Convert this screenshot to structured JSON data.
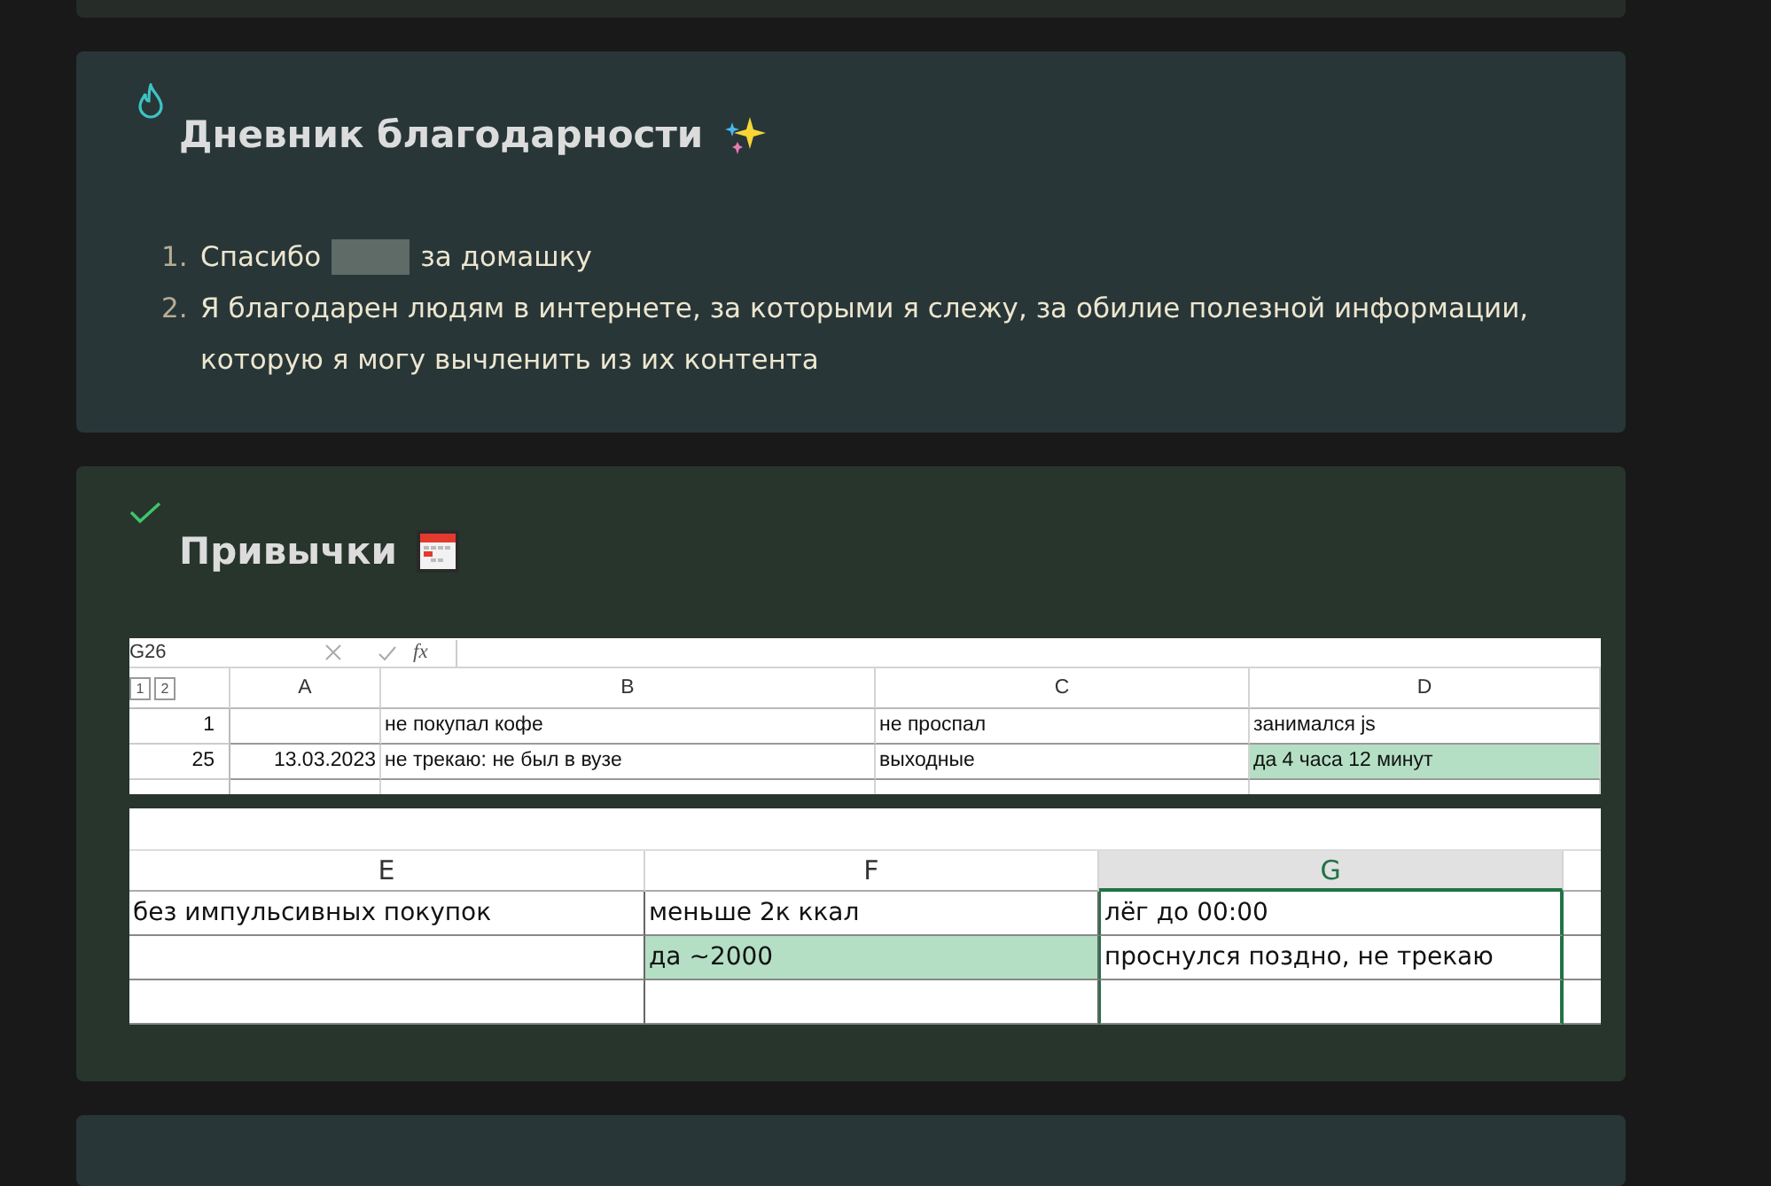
{
  "gratitude": {
    "title": "Дневник благодарности",
    "items": [
      {
        "number": "1.",
        "before": "Спасибо",
        "redacted": true,
        "after": "за домашку"
      },
      {
        "number": "2.",
        "before": "Я благодарен людям в интернете, за которыми я слежу, за обилие полезной информации, которую я могу вычленить из их контента",
        "redacted": false
      }
    ]
  },
  "habits": {
    "title": "Привычки",
    "sheet_top": {
      "name_box": "G26",
      "outline_levels": [
        "1",
        "2"
      ],
      "fx": "fx",
      "columns": [
        {
          "label": "A"
        },
        {
          "label": "B"
        },
        {
          "label": "C"
        },
        {
          "label": "D"
        }
      ],
      "rows": [
        {
          "header": "1",
          "cells": [
            {
              "filled": false
            },
            {
              "text": "не покупал кофе",
              "filled": false
            },
            {
              "text": "не проспал",
              "filled": false
            },
            {
              "text": "занимался js",
              "filled": false
            }
          ]
        },
        {
          "header": "25",
          "cells": [
            {
              "text": "13.03.2023",
              "filled": false
            },
            {
              "text": "не трекаю: не был в вузе",
              "filled": false
            },
            {
              "text": "выходные",
              "filled": false
            },
            {
              "text": "да 4 часа 12 минут",
              "filled": true
            }
          ]
        }
      ]
    },
    "sheet_bottom": {
      "columns": [
        {
          "label": "E",
          "selected": false
        },
        {
          "label": "F",
          "selected": false
        },
        {
          "label": "G",
          "selected": true
        }
      ],
      "rows": [
        {
          "cells": [
            {
              "text": "без импульсивных покупок",
              "filled": false
            },
            {
              "text": "меньше 2к ккал",
              "filled": false
            },
            {
              "text": "лёг до 00:00",
              "filled": false
            }
          ]
        },
        {
          "cells": [
            {
              "filled": false
            },
            {
              "text": "да ~2000",
              "filled": true
            },
            {
              "text": "проснулся поздно, не трекаю",
              "filled": false
            }
          ]
        },
        {
          "cells": [
            {
              "filled": false
            },
            {
              "filled": false
            },
            {
              "filled": false
            }
          ]
        }
      ]
    }
  }
}
